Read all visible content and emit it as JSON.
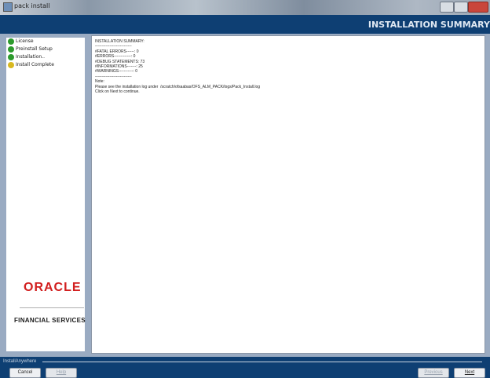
{
  "window": {
    "title": "pack install"
  },
  "header": {
    "title": "INSTALLATION SUMMARY"
  },
  "sidebar": {
    "items": [
      {
        "label": "License",
        "icon": "check-circle-icon",
        "status_color": "#2c9a2c"
      },
      {
        "label": "Preinstall Setup",
        "icon": "check-circle-icon",
        "status_color": "#2c9a2c"
      },
      {
        "label": "Installation..",
        "icon": "check-circle-icon",
        "status_color": "#2c9a2c"
      },
      {
        "label": "Install Complete",
        "icon": "arrow-circle-icon",
        "status_color": "#d8b820"
      }
    ],
    "brand_logo": "ORACLE",
    "brand_sub": "FINANCIAL SERVICES"
  },
  "summary": {
    "heading": "INSTALLATION SUMMARY:",
    "separator": "----------------------------",
    "lines": [
      {
        "label": "#FATAL ERRORS------:",
        "value": "0"
      },
      {
        "label": "#ERRORS-------------:",
        "value": "0"
      },
      {
        "label": "#DEBUG STATEMENTS:",
        "value": "73"
      },
      {
        "label": "#INFORMATIONS-------:",
        "value": "25"
      },
      {
        "label": "#WARNINGS-----------:",
        "value": "0"
      }
    ],
    "note": "Note:",
    "log_message": "Please see the installation log under  /scratch/ofsaabas/OFS_ALM_PACK/logs/Pack_Install.log",
    "continue_message": "Click on Next to continue."
  },
  "footer": {
    "brand": "InstallAnywhere",
    "cancel": "Cancel",
    "help": "Help",
    "previous": "Previous",
    "next": "Next"
  },
  "colors": {
    "header_bg": "#0e3f73",
    "shell_bg": "#9aabc2",
    "oracle_red": "#d21f1f"
  }
}
